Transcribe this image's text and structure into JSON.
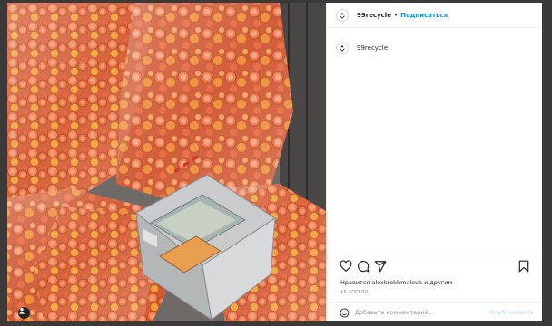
{
  "post": {
    "author": {
      "username": "99recycle",
      "follow_label": "Подписаться",
      "separator": "•"
    },
    "caption": {
      "username": "99recycle"
    },
    "likes_text": "Нравится alexkrokhmaleva и другим",
    "date_text": "15 АПРЕЛЯ",
    "comment": {
      "placeholder": "Добавьте комментарий...",
      "publish_label": "Опубликовать"
    },
    "icons": {
      "like": "heart-icon",
      "comment": "comment-icon",
      "share": "share-icon",
      "save": "bookmark-icon",
      "emoji": "emoji-icon",
      "avatar": "recycle-logo-icon",
      "user": "user-icon"
    },
    "colors": {
      "link": "#0095f6",
      "text": "#262626",
      "muted": "#8e8e8e",
      "publish_disabled": "#b2dffc",
      "caps_orange": "#e8653a"
    }
  }
}
